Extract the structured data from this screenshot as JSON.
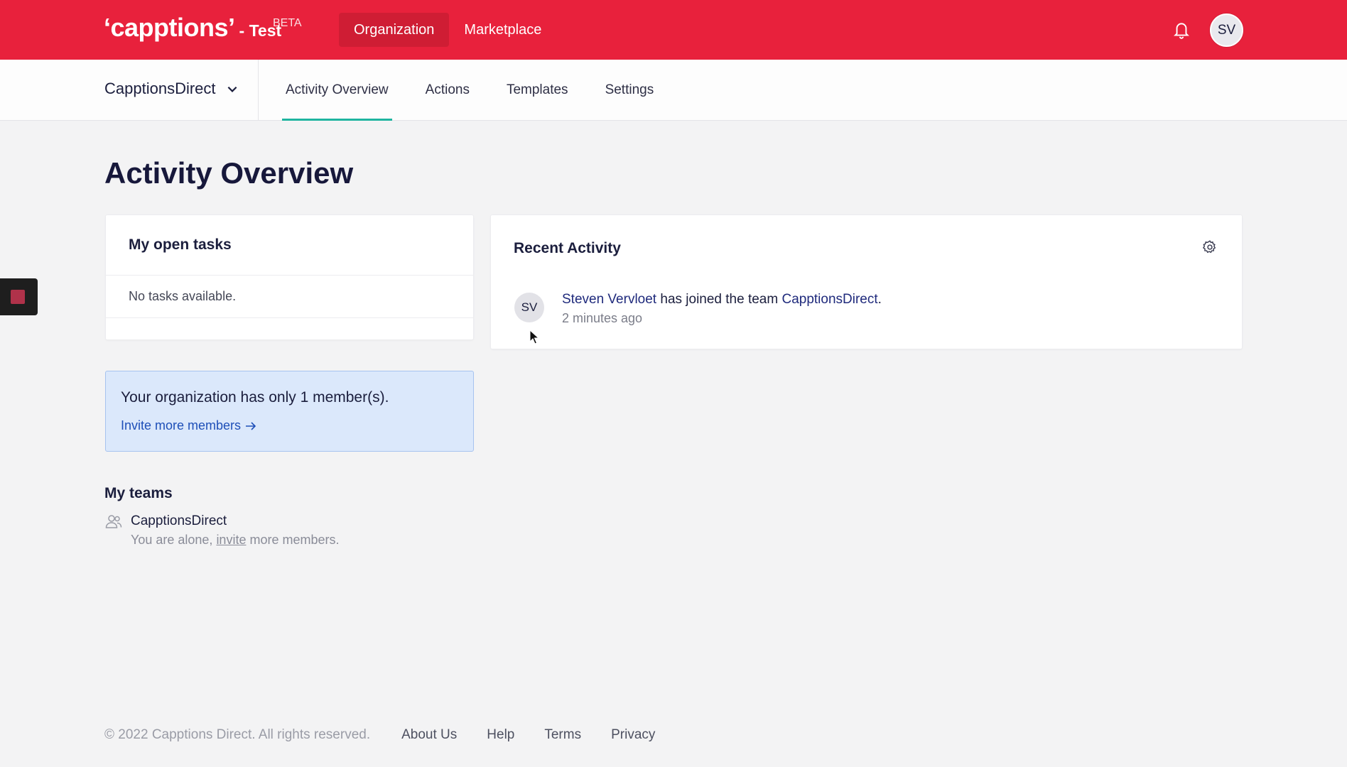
{
  "brand": {
    "logo": "‘capptions’",
    "suffix": "- Test",
    "badge": "BETA"
  },
  "topnav": {
    "items": [
      {
        "label": "Organization",
        "active": true
      },
      {
        "label": "Marketplace",
        "active": false
      }
    ],
    "avatar_initials": "SV"
  },
  "subnav": {
    "team": "CapptionsDirect",
    "tabs": [
      {
        "label": "Activity Overview",
        "active": true
      },
      {
        "label": "Actions",
        "active": false
      },
      {
        "label": "Templates",
        "active": false
      },
      {
        "label": "Settings",
        "active": false
      }
    ]
  },
  "page": {
    "title": "Activity Overview"
  },
  "tasks": {
    "title": "My open tasks",
    "empty": "No tasks available."
  },
  "activity": {
    "title": "Recent Activity",
    "items": [
      {
        "initials": "SV",
        "user": "Steven Vervloet",
        "action": " has joined the team ",
        "team": "CapptionsDirect",
        "end": ".",
        "time": "2 minutes ago"
      }
    ]
  },
  "notice": {
    "message": "Your organization has only 1 member(s).",
    "link": "Invite more members"
  },
  "teams": {
    "title": "My teams",
    "items": [
      {
        "name": "CapptionsDirect",
        "sub_before": "You are alone, ",
        "sub_link": "invite",
        "sub_after": " more members."
      }
    ]
  },
  "footer": {
    "copyright": "© 2022 Capptions Direct. All rights reserved.",
    "links": [
      "About Us",
      "Help",
      "Terms",
      "Privacy"
    ]
  },
  "colors": {
    "header": "#e8213c",
    "tab_underline": "#1fb5a0",
    "link": "#1f2a7c",
    "notice_bg": "#dbe8fb"
  }
}
